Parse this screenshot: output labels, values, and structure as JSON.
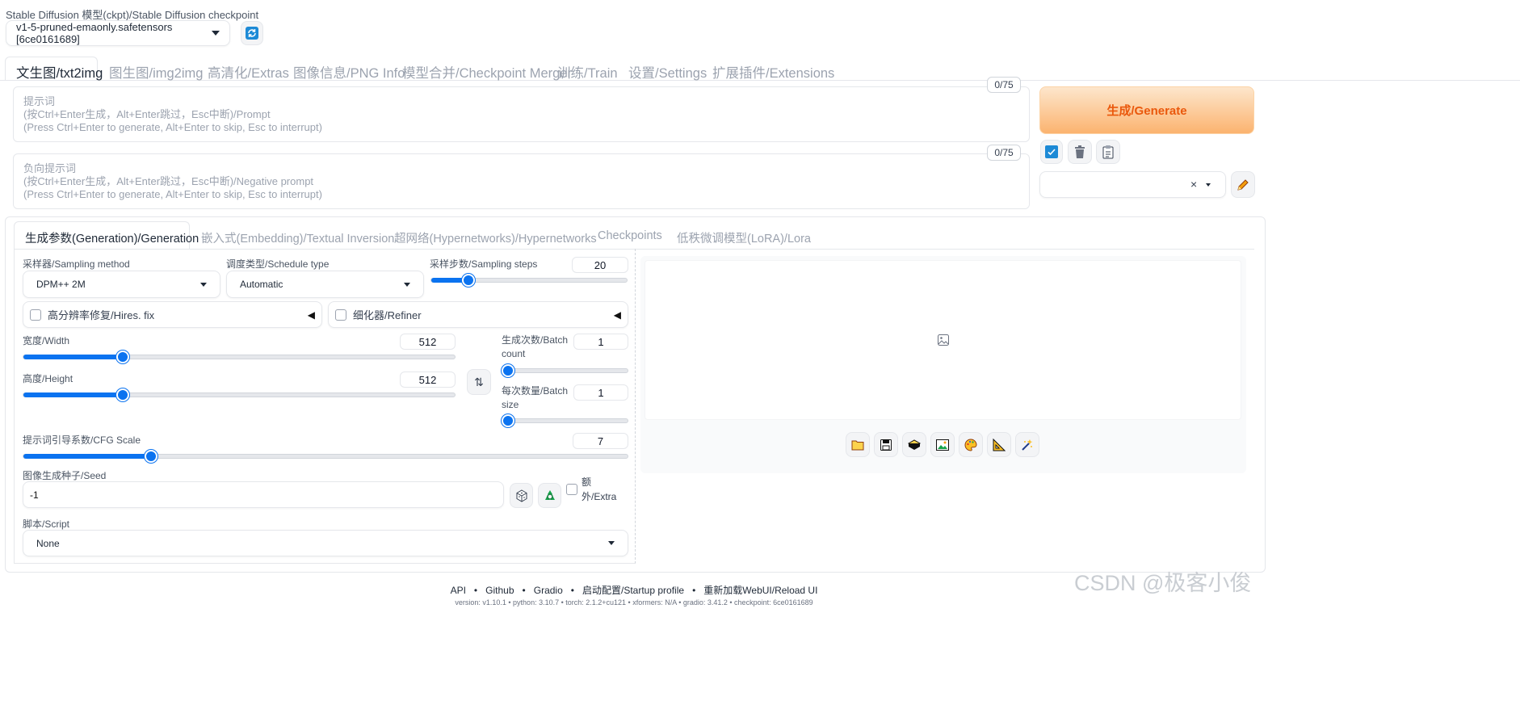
{
  "checkpoint": {
    "label": "Stable Diffusion 模型(ckpt)/Stable Diffusion checkpoint",
    "value": "v1-5-pruned-emaonly.safetensors [6ce0161689]"
  },
  "main_tabs": [
    "文生图/txt2img",
    "图生图/img2img",
    "高清化/Extras",
    "图像信息/PNG Info",
    "模型合并/Checkpoint Merger",
    "训练/Train",
    "设置/Settings",
    "扩展插件/Extensions"
  ],
  "prompt": {
    "counter": "0/75",
    "placeholder_l1": "提示词",
    "placeholder_l2": "(按Ctrl+Enter生成，Alt+Enter跳过，Esc中断)/Prompt",
    "placeholder_l3": "(Press Ctrl+Enter to generate, Alt+Enter to skip, Esc to interrupt)"
  },
  "negative_prompt": {
    "counter": "0/75",
    "placeholder_l1": "负向提示词",
    "placeholder_l2": "(按Ctrl+Enter生成，Alt+Enter跳过，Esc中断)/Negative prompt",
    "placeholder_l3": "(Press Ctrl+Enter to generate, Alt+Enter to skip, Esc to interrupt)"
  },
  "generate_button": "生成/Generate",
  "style_clear": "×",
  "sub_tabs": [
    "生成参数(Generation)/Generation",
    "嵌入式(Embedding)/Textual Inversion",
    "超网络(Hypernetworks)/Hypernetworks",
    "Checkpoints",
    "低秩微调模型(LoRA)/Lora"
  ],
  "sampler": {
    "label": "采样器/Sampling method",
    "value": "DPM++ 2M"
  },
  "schedule": {
    "label": "调度类型/Schedule type",
    "value": "Automatic"
  },
  "steps": {
    "label": "采样步数/Sampling steps",
    "value": "20",
    "fraction": 0.19
  },
  "hires": {
    "label": "高分辨率修复/Hires. fix",
    "checked": false
  },
  "refiner": {
    "label": "细化器/Refiner",
    "checked": false
  },
  "width": {
    "label": "宽度/Width",
    "value": "512",
    "fraction": 0.23
  },
  "height": {
    "label": "高度/Height",
    "value": "512",
    "fraction": 0.23
  },
  "batch_count": {
    "label_l1": "生成次数/Batch",
    "label_l2": "count",
    "value": "1",
    "fraction": 0
  },
  "batch_size": {
    "label_l1": "每次数量/Batch",
    "label_l2": "size",
    "value": "1",
    "fraction": 0
  },
  "cfg": {
    "label": "提示词引导系数/CFG Scale",
    "value": "7",
    "fraction": 0.21
  },
  "seed": {
    "label": "图像生成种子/Seed",
    "value": "-1"
  },
  "extra": {
    "label_l1": "额",
    "label_l2": "外/Extra"
  },
  "script": {
    "label": "脚本/Script",
    "value": "None"
  },
  "footer": {
    "links": [
      "API",
      "Github",
      "Gradio",
      "启动配置/Startup profile",
      "重新加载WebUI/Reload UI"
    ],
    "separator": "•",
    "version_line": "version: v1.10.1  •  python: 3.10.7  •  torch: 2.1.2+cu121  •  xformers: N/A  •  gradio: 3.41.2  •  checkpoint: 6ce0161689"
  },
  "watermark": "CSDN @极客小俊",
  "colors": {
    "accent": "#0b73f0",
    "generate_gradient_start": "#fde6cc",
    "generate_gradient_end": "#fbb36f",
    "generate_text": "#ea580c"
  },
  "icons": {
    "refresh": "refresh-icon",
    "image_placeholder": "image-icon",
    "output_tools": [
      "folder-icon",
      "save-icon",
      "zip-icon",
      "send-to-img2img-icon",
      "send-to-inpaint-icon",
      "send-to-extras-icon",
      "sparkle-icon"
    ]
  }
}
